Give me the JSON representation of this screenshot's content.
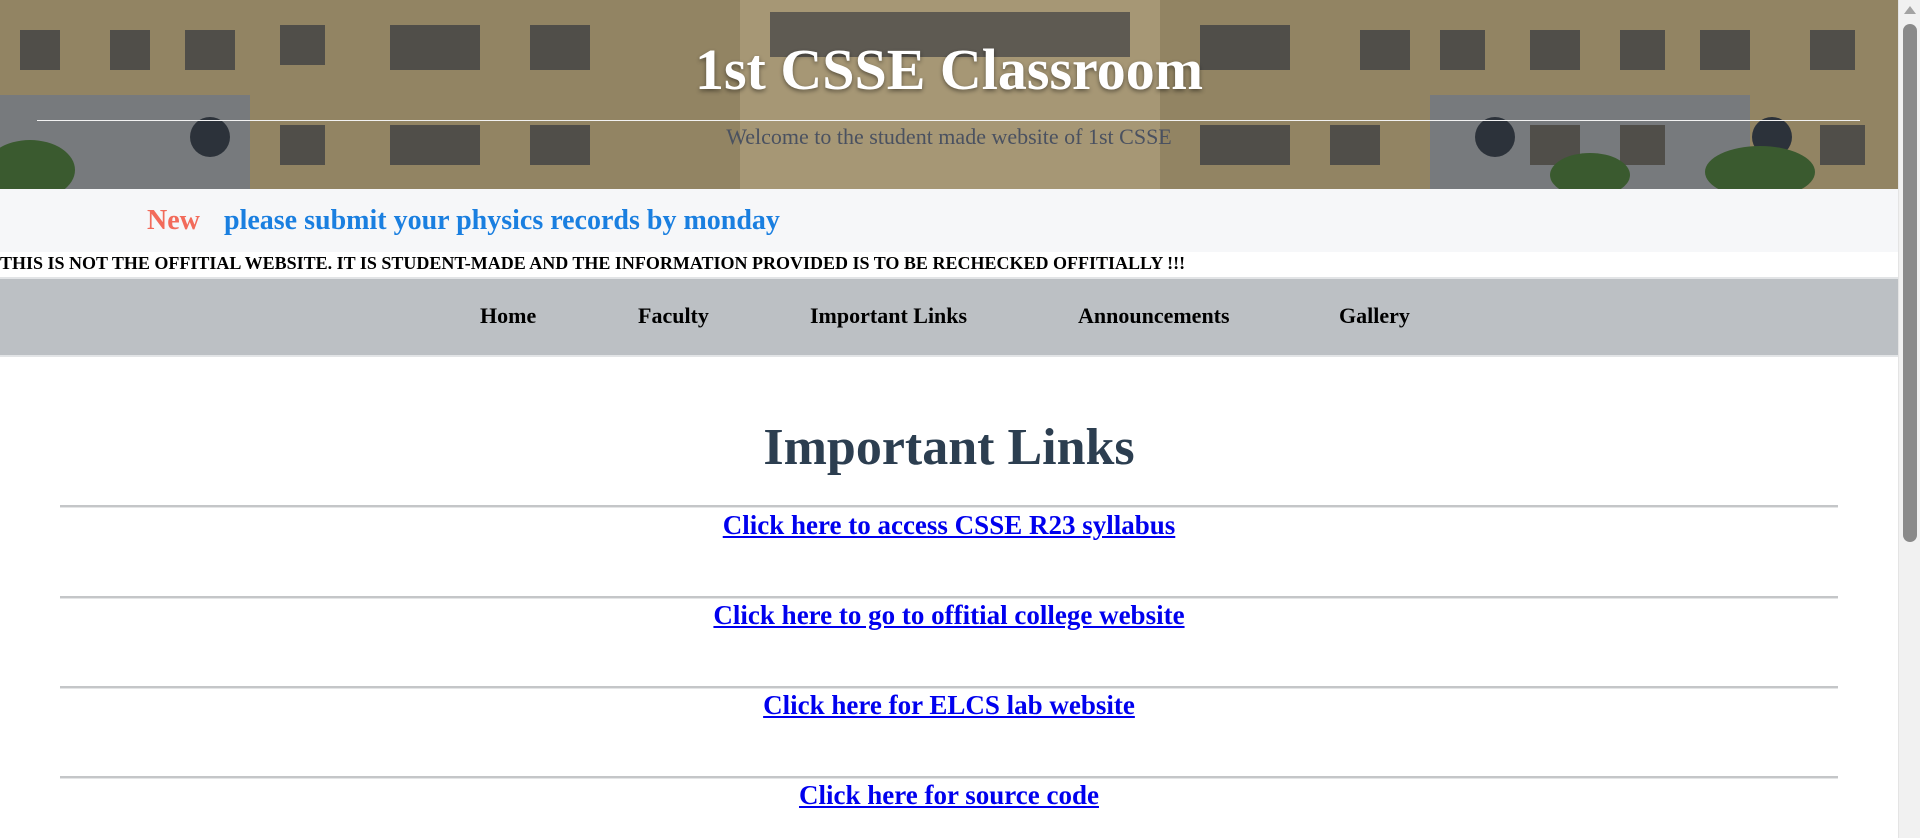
{
  "header": {
    "title": "1st CSSE Classroom",
    "subtitle": "Welcome to the student made website of 1st CSSE"
  },
  "announcement": {
    "tag": "New",
    "text": "please submit your physics records by monday",
    "tag_color": "#f26b5b",
    "text_color": "#1a7fe0"
  },
  "disclaimer": "THIS IS NOT THE OFFITIAL WEBSITE. IT IS STUDENT-MADE AND THE INFORMATION PROVIDED IS TO BE RECHECKED OFFITIALLY !!!",
  "nav": {
    "items": [
      {
        "label": "Home"
      },
      {
        "label": "Faculty"
      },
      {
        "label": "Important Links"
      },
      {
        "label": "Announcements"
      },
      {
        "label": "Gallery"
      }
    ],
    "background": "#bcc0c4"
  },
  "main": {
    "title": "Important Links",
    "links": [
      {
        "label": "Click here to access CSSE R23 syllabus"
      },
      {
        "label": "Click here to go to offitial college website"
      },
      {
        "label": "Click here for ELCS lab website"
      },
      {
        "label": "Click here for source code"
      }
    ],
    "link_color": "#0000ee",
    "title_color": "#2c3e50"
  }
}
